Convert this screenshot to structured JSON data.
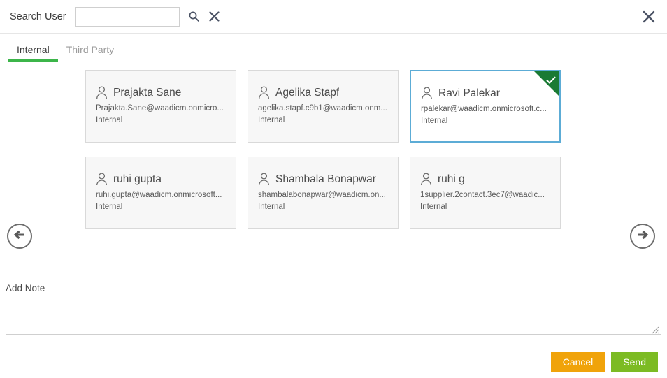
{
  "header": {
    "search_label": "Search User",
    "search_value": "",
    "search_placeholder": "",
    "search_icon": "search-icon",
    "clear_icon": "clear-icon",
    "close_icon": "close-icon"
  },
  "tabs": [
    {
      "label": "Internal",
      "active": true
    },
    {
      "label": "Third Party",
      "active": false
    }
  ],
  "nav": {
    "prev_icon": "arrow-left-icon",
    "next_icon": "arrow-right-icon"
  },
  "cards": [
    {
      "name": "Prajakta Sane",
      "email": "Prajakta.Sane@waadicm.onmicro...",
      "type": "Internal",
      "selected": false
    },
    {
      "name": "Agelika Stapf",
      "email": "agelika.stapf.c9b1@waadicm.onm...",
      "type": "Internal",
      "selected": false
    },
    {
      "name": "Ravi Palekar",
      "email": "rpalekar@waadicm.onmicrosoft.c...",
      "type": "Internal",
      "selected": true
    },
    {
      "name": "ruhi gupta",
      "email": "ruhi.gupta@waadicm.onmicrosoft...",
      "type": "Internal",
      "selected": false
    },
    {
      "name": "Shambala Bonapwar",
      "email": "shambalabonapwar@waadicm.on...",
      "type": "Internal",
      "selected": false
    },
    {
      "name": "ruhi g",
      "email": "1supplier.2contact.3ec7@waadic...",
      "type": "Internal",
      "selected": false
    }
  ],
  "note": {
    "label": "Add Note",
    "value": "",
    "placeholder": ""
  },
  "footer": {
    "cancel_label": "Cancel",
    "send_label": "Send"
  },
  "colors": {
    "tab_active_underline": "#3cb54a",
    "selected_card_border": "#5cacd6",
    "selected_corner": "#1a7a34",
    "cancel_button": "#f0a30a",
    "send_button": "#7cbb23"
  }
}
